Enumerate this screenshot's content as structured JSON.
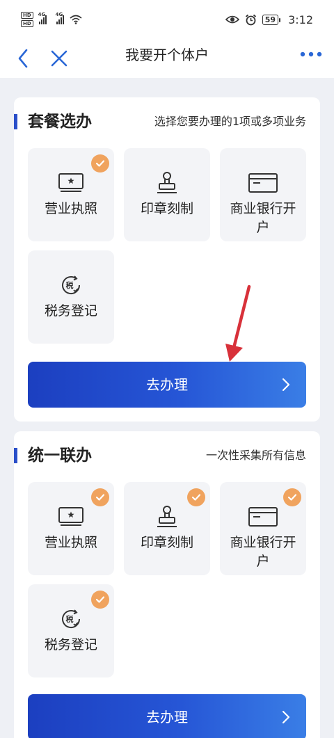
{
  "status_bar": {
    "hd1": "HD",
    "hd2": "HD",
    "net1": "4G",
    "net2": "4G",
    "battery": "59",
    "time": "3:12"
  },
  "nav": {
    "title": "我要开个体户"
  },
  "sections": [
    {
      "title": "套餐选办",
      "subtitle": "选择您要办理的1项或多项业务",
      "items": [
        {
          "label": "营业执照",
          "icon": "license-icon",
          "checked": true
        },
        {
          "label": "印章刻制",
          "icon": "seal-icon",
          "checked": false
        },
        {
          "label": "商业银行开户",
          "icon": "bank-card-icon",
          "checked": false
        },
        {
          "label": "税务登记",
          "icon": "tax-icon",
          "checked": false
        }
      ],
      "button_label": "去办理"
    },
    {
      "title": "统一联办",
      "subtitle": "一次性采集所有信息",
      "items": [
        {
          "label": "营业执照",
          "icon": "license-icon",
          "checked": true
        },
        {
          "label": "印章刻制",
          "icon": "seal-icon",
          "checked": true
        },
        {
          "label": "商业银行开户",
          "icon": "bank-card-icon",
          "checked": true
        },
        {
          "label": "税务登记",
          "icon": "tax-icon",
          "checked": true
        }
      ],
      "button_label": "去办理"
    }
  ],
  "tax_icon_glyph": "税",
  "colors": {
    "accent": "#2a4fc9",
    "check": "#f0a35e",
    "button_start": "#1c3fc0",
    "button_end": "#3a7ee6",
    "annotation_arrow": "#d8313a"
  }
}
